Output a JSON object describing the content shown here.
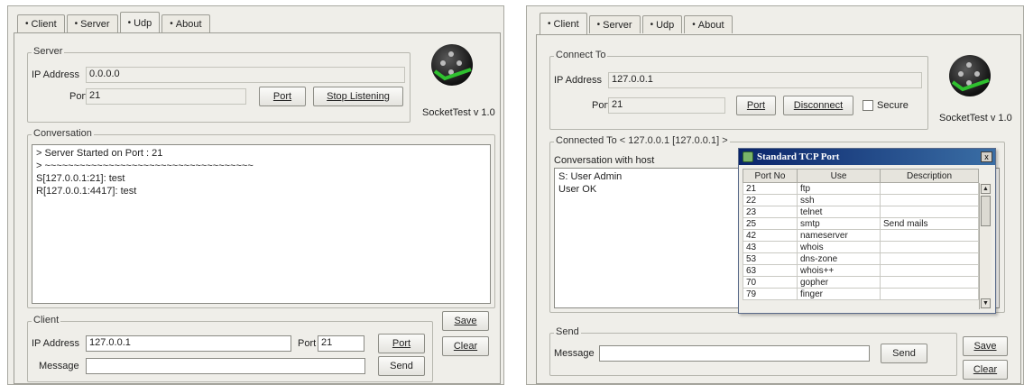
{
  "left_app": {
    "tabs": [
      {
        "label": "Client",
        "active": false
      },
      {
        "label": "Server",
        "active": false
      },
      {
        "label": "Udp",
        "active": true
      },
      {
        "label": "About",
        "active": false
      }
    ],
    "server_group": {
      "legend": "Server",
      "ip_label": "IP Address",
      "ip_value": "0.0.0.0",
      "port_label": "Port",
      "port_value": "21",
      "port_button": "Port",
      "stop_button": "Stop Listening"
    },
    "logo_caption": "SocketTest v 1.0",
    "conversation": {
      "legend": "Conversation",
      "lines": "> Server Started on Port : 21\n> ~~~~~~~~~~~~~~~~~~~~~~~~~~~~~~~~~~~~\nS[127.0.0.1:21]: test\nR[127.0.0.1:4417]: test"
    },
    "client_group": {
      "legend": "Client",
      "ip_label": "IP Address",
      "ip_value": "127.0.0.1",
      "port_label": "Port",
      "port_value": "21",
      "port_button": "Port",
      "message_label": "Message",
      "message_value": "",
      "send_button": "Send"
    },
    "save_button": "Save",
    "clear_button": "Clear"
  },
  "right_app": {
    "tabs": [
      {
        "label": "Client",
        "active": true
      },
      {
        "label": "Server",
        "active": false
      },
      {
        "label": "Udp",
        "active": false
      },
      {
        "label": "About",
        "active": false
      }
    ],
    "connect_group": {
      "legend": "Connect To",
      "ip_label": "IP Address",
      "ip_value": "127.0.0.1",
      "port_label": "Port",
      "port_value": "21",
      "port_button": "Port",
      "disconnect_button": "Disconnect",
      "secure_label": "Secure"
    },
    "logo_caption": "SocketTest v 1.0",
    "connected_group": {
      "legend": "Connected To < 127.0.0.1 [127.0.0.1] >",
      "conversation_label": "Conversation with host",
      "lines": "S: User Admin\nUser OK"
    },
    "popup": {
      "title": "Standard TCP Port",
      "close": "x",
      "columns": [
        "Port No",
        "Use",
        "Description"
      ],
      "rows": [
        [
          "21",
          "ftp",
          ""
        ],
        [
          "22",
          "ssh",
          ""
        ],
        [
          "23",
          "telnet",
          ""
        ],
        [
          "25",
          "smtp",
          "Send mails"
        ],
        [
          "42",
          "nameserver",
          ""
        ],
        [
          "43",
          "whois",
          ""
        ],
        [
          "53",
          "dns-zone",
          ""
        ],
        [
          "63",
          "whois++",
          ""
        ],
        [
          "70",
          "gopher",
          ""
        ],
        [
          "79",
          "finger",
          ""
        ]
      ]
    },
    "send_group": {
      "legend": "Send",
      "message_label": "Message",
      "message_value": "",
      "send_button": "Send"
    },
    "save_button": "Save",
    "clear_button": "Clear"
  }
}
